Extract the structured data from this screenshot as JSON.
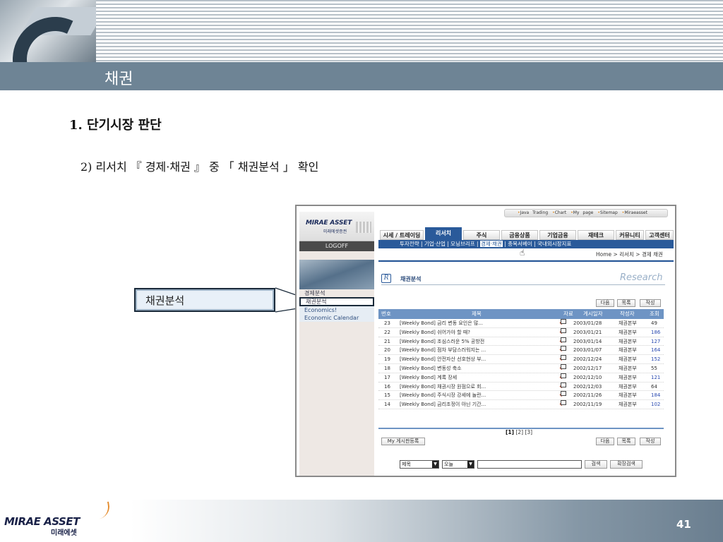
{
  "slide": {
    "title": "채권",
    "heading1": "1. 단기시장 판단",
    "heading2": "2) 리서치 『 경제·채권 』 중 「 채권분석 」 확인",
    "callout": "채권분석",
    "page_number": "41",
    "footer_logo": "MIRAE ASSET",
    "footer_logo_sub": "미래에셋"
  },
  "site": {
    "logo": "MIRAE ASSET",
    "logo_sub": "미래에셋증권",
    "logoff": "LOGOFF",
    "util_links": [
      "Java Trading",
      "Chart",
      "My page",
      "Sitemap",
      "Miraeasset"
    ],
    "menu": [
      "시세 / 트레이딩",
      "리서치",
      "주식",
      "금융상품",
      "기업금융",
      "재테크",
      "커뮤니티",
      "고객센터"
    ],
    "submenu_text": "투자전략 | 기업·산업 | 모닝브리프 | ",
    "submenu_active": "경제·채권",
    "submenu_rest": " | 종목서베이 | 국내외시장지표",
    "breadcrumb": "Home > 리서치 > 경제 채권",
    "side_menu": [
      "경제분석",
      "채권분석",
      "Economics!",
      "Economic Calendar"
    ],
    "content_title": "채권분석",
    "research_label": "Research",
    "btn_next": "다음",
    "btn_list": "목록",
    "btn_write": "작성",
    "columns": [
      "번호",
      "제목",
      "자료",
      "게시일자",
      "작성자",
      "조회"
    ],
    "rows": [
      {
        "no": "23",
        "title": "[Weekly Bond] 금리 변동 요인은 많...",
        "date": "2003/01/28",
        "author": "채권본부",
        "views": "49"
      },
      {
        "no": "22",
        "title": "[Weekly Bond] 쉬어가야 할 때?",
        "date": "2003/01/21",
        "author": "채권본부",
        "views": "186"
      },
      {
        "no": "21",
        "title": "[Weekly Bond] 조심스러운 5% 공방전",
        "date": "2003/01/14",
        "author": "채권본부",
        "views": "127"
      },
      {
        "no": "20",
        "title": "[Weekly Bond] 점차 부담스러워지는 ...",
        "date": "2003/01/07",
        "author": "채권본부",
        "views": "164"
      },
      {
        "no": "19",
        "title": "[Weekly Bond] 안전자산 선호현상 부...",
        "date": "2002/12/24",
        "author": "채권본부",
        "views": "152"
      },
      {
        "no": "18",
        "title": "[Weekly Bond] 변동성 축소",
        "date": "2002/12/17",
        "author": "채권본부",
        "views": "55"
      },
      {
        "no": "17",
        "title": "[Weekly Bond] 계록 장세",
        "date": "2002/12/10",
        "author": "채권본부",
        "views": "121"
      },
      {
        "no": "16",
        "title": "[Weekly Bond] 채권시장 원점으로 회...",
        "date": "2002/12/03",
        "author": "채권본부",
        "views": "64"
      },
      {
        "no": "15",
        "title": "[Weekly Bond] 주식시장 강세에 놀란...",
        "date": "2002/11/26",
        "author": "채권본부",
        "views": "184"
      },
      {
        "no": "14",
        "title": "[Weekly Bond] 금리조정이 아닌 기간...",
        "date": "2002/11/19",
        "author": "채권본부",
        "views": "102"
      }
    ],
    "pager_current": "[1]",
    "pager_rest": " [2] [3]",
    "my_board_btn": "My 게시판등록",
    "search_field": "제목",
    "search_period": "오늘",
    "search_btn": "검색",
    "ext_search_btn": "확장검색"
  }
}
